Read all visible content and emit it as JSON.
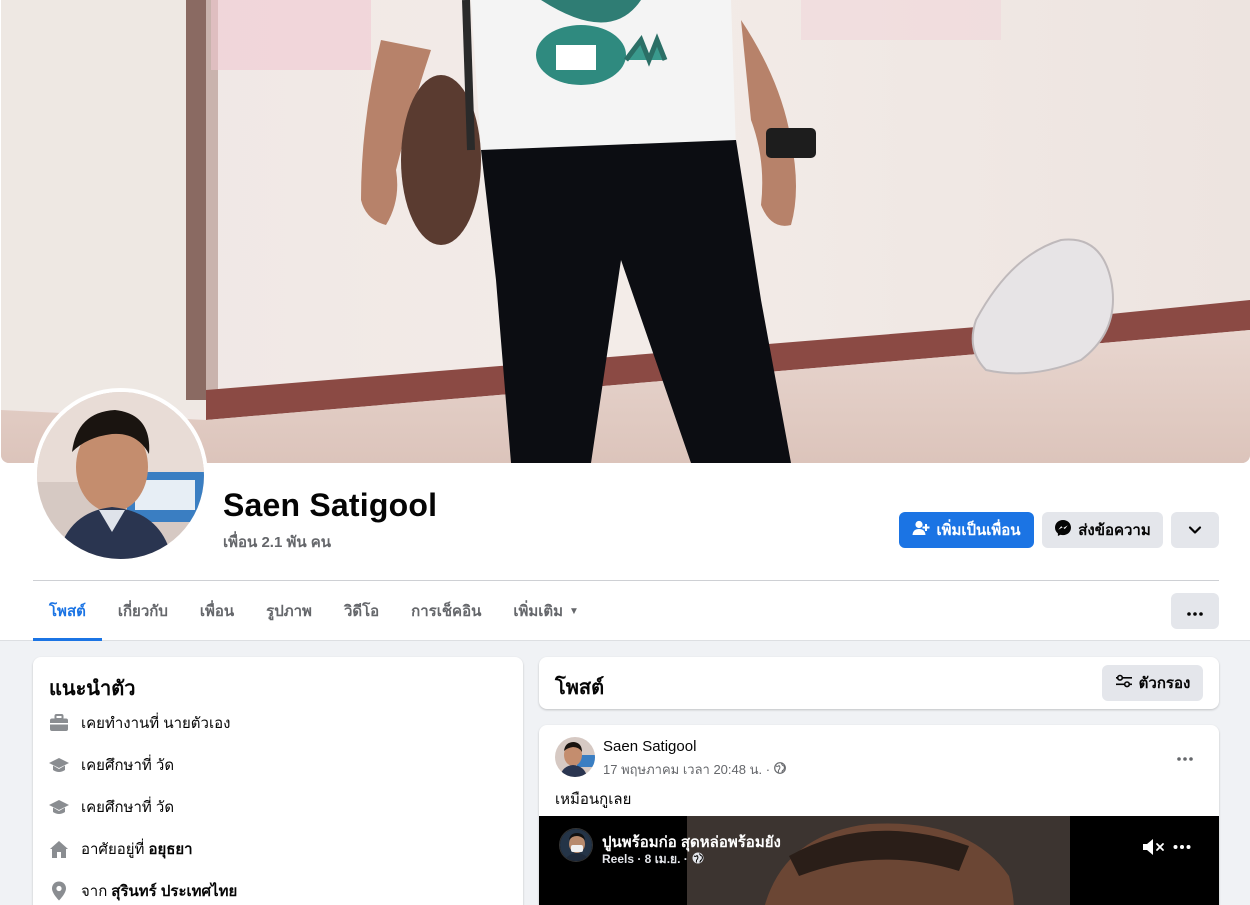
{
  "profile": {
    "name": "Saen Satigool",
    "friends": "เพื่อน 2.1 พัน คน"
  },
  "actions": {
    "add_friend": "เพิ่มเป็นเพื่อน",
    "message": "ส่งข้อความ"
  },
  "tabs": [
    {
      "label": "โพสต์"
    },
    {
      "label": "เกี่ยวกับ"
    },
    {
      "label": "เพื่อน"
    },
    {
      "label": "รูปภาพ"
    },
    {
      "label": "วิดีโอ"
    },
    {
      "label": "การเช็คอิน"
    },
    {
      "label": "เพิ่มเติม"
    }
  ],
  "intro": {
    "title": "แนะนำตัว",
    "items": [
      {
        "icon": "briefcase-icon",
        "text": "เคยทำงานที่ นายตัวเอง",
        "bold": ""
      },
      {
        "icon": "graduation-cap-icon",
        "text": "เคยศึกษาที่ วัด",
        "bold": ""
      },
      {
        "icon": "graduation-cap-icon",
        "text": "เคยศึกษาที่ วัด",
        "bold": ""
      },
      {
        "icon": "home-icon",
        "text": "อาศัยอยู่ที่",
        "bold": "อยุธยา"
      },
      {
        "icon": "location-pin-icon",
        "text": "จาก",
        "bold": "สุรินทร์ ประเทศไทย"
      }
    ]
  },
  "posts": {
    "title": "โพสต์",
    "filter_label": "ตัวกรอง"
  },
  "post": {
    "author": "Saen Satigool",
    "time": "17 พฤษภาคม เวลา 20:48 น. ·",
    "text": "เหมือนกูเลย",
    "reel": {
      "title": "ปูนพร้อมก่อ สุดหล่อพร้อมยัง",
      "meta": "Reels · 8 เม.ย. ·"
    }
  },
  "colors": {
    "accent": "#1b74e4",
    "secondary_button": "#e4e6eb",
    "page_bg": "#f0f2f5",
    "muted_text": "#65676b"
  }
}
